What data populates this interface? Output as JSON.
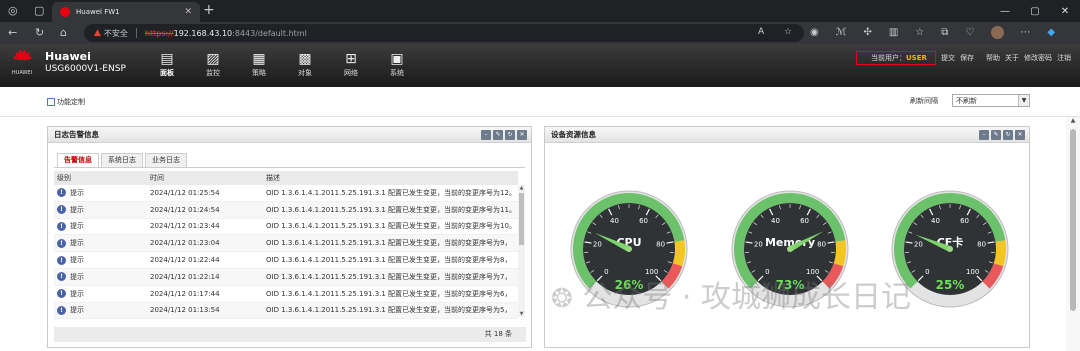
{
  "browser": {
    "tab_title": "Huawei FW1",
    "security_label": "不安全",
    "url_scheme": "https://",
    "url_host": "192.168.43.10",
    "url_path": ":8443/default.html"
  },
  "app": {
    "brand_logo_text": "HUAWEI",
    "brand_name": "Huawei",
    "device_model": "USG6000V1-ENSP",
    "nav": [
      {
        "label": "面板",
        "icon": "dashboard-icon"
      },
      {
        "label": "监控",
        "icon": "monitor-icon"
      },
      {
        "label": "策略",
        "icon": "policy-icon"
      },
      {
        "label": "对象",
        "icon": "object-icon"
      },
      {
        "label": "网络",
        "icon": "network-icon"
      },
      {
        "label": "系统",
        "icon": "system-icon"
      }
    ],
    "current_user_label": "当前用户：",
    "current_user": "USER",
    "right_links": [
      "提交",
      "保存",
      "帮助",
      "关于",
      "修改密码",
      "注销"
    ]
  },
  "toolbar": {
    "customize_label": "功能定制",
    "refresh_label": "刷新间隔",
    "refresh_value": "不刷新"
  },
  "log_panel": {
    "title": "日志告警信息",
    "tabs": [
      "告警信息",
      "系统日志",
      "业务日志"
    ],
    "active_tab": 0,
    "columns": [
      "级别",
      "时间",
      "描述"
    ],
    "rows": [
      {
        "level": "提示",
        "time": "2024/1/12 01:25:54",
        "desc": "OID 1.3.6.1.4.1.2011.5.25.191.3.1 配置已发生变更，当前的变更序号为12。"
      },
      {
        "level": "提示",
        "time": "2024/1/12 01:24:54",
        "desc": "OID 1.3.6.1.4.1.2011.5.25.191.3.1 配置已发生变更，当前的变更序号为11。"
      },
      {
        "level": "提示",
        "time": "2024/1/12 01:23:44",
        "desc": "OID 1.3.6.1.4.1.2011.5.25.191.3.1 配置已发生变更，当前的变更序号为10。"
      },
      {
        "level": "提示",
        "time": "2024/1/12 01:23:04",
        "desc": "OID 1.3.6.1.4.1.2011.5.25.191.3.1 配置已发生变更，当前的变更序号为9，"
      },
      {
        "level": "提示",
        "time": "2024/1/12 01:22:44",
        "desc": "OID 1.3.6.1.4.1.2011.5.25.191.3.1 配置已发生变更，当前的变更序号为8，"
      },
      {
        "level": "提示",
        "time": "2024/1/12 01:22:14",
        "desc": "OID 1.3.6.1.4.1.2011.5.25.191.3.1 配置已发生变更，当前的变更序号为7，"
      },
      {
        "level": "提示",
        "time": "2024/1/12 01:17:44",
        "desc": "OID 1.3.6.1.4.1.2011.5.25.191.3.1 配置已发生变更，当前的变更序号为6，"
      },
      {
        "level": "提示",
        "time": "2024/1/12 01:13:54",
        "desc": "OID 1.3.6.1.4.1.2011.5.25.191.3.1 配置已发生变更，当前的变更序号为5，"
      }
    ],
    "footer": "共 18 条"
  },
  "resource_panel": {
    "title": "设备资源信息",
    "scale_ticks": [
      "0",
      "20",
      "40",
      "60",
      "80",
      "100"
    ],
    "gauges": [
      {
        "label": "CPU",
        "percent": 26,
        "percent_text": "26%"
      },
      {
        "label": "Memory",
        "percent": 73,
        "percent_text": "73%"
      },
      {
        "label": "CF卡",
        "percent": 25,
        "percent_text": "25%"
      }
    ]
  },
  "watermark": "公众号 · 攻城狮成长日记",
  "colors": {
    "gauge_green": "#6cc26a",
    "gauge_yellow": "#f3c623",
    "gauge_red": "#e9595a",
    "gauge_face": "#2f3336",
    "gauge_value_green": "#6dde5a",
    "user_highlight": "#e60012",
    "user_name": "#f1b400"
  }
}
